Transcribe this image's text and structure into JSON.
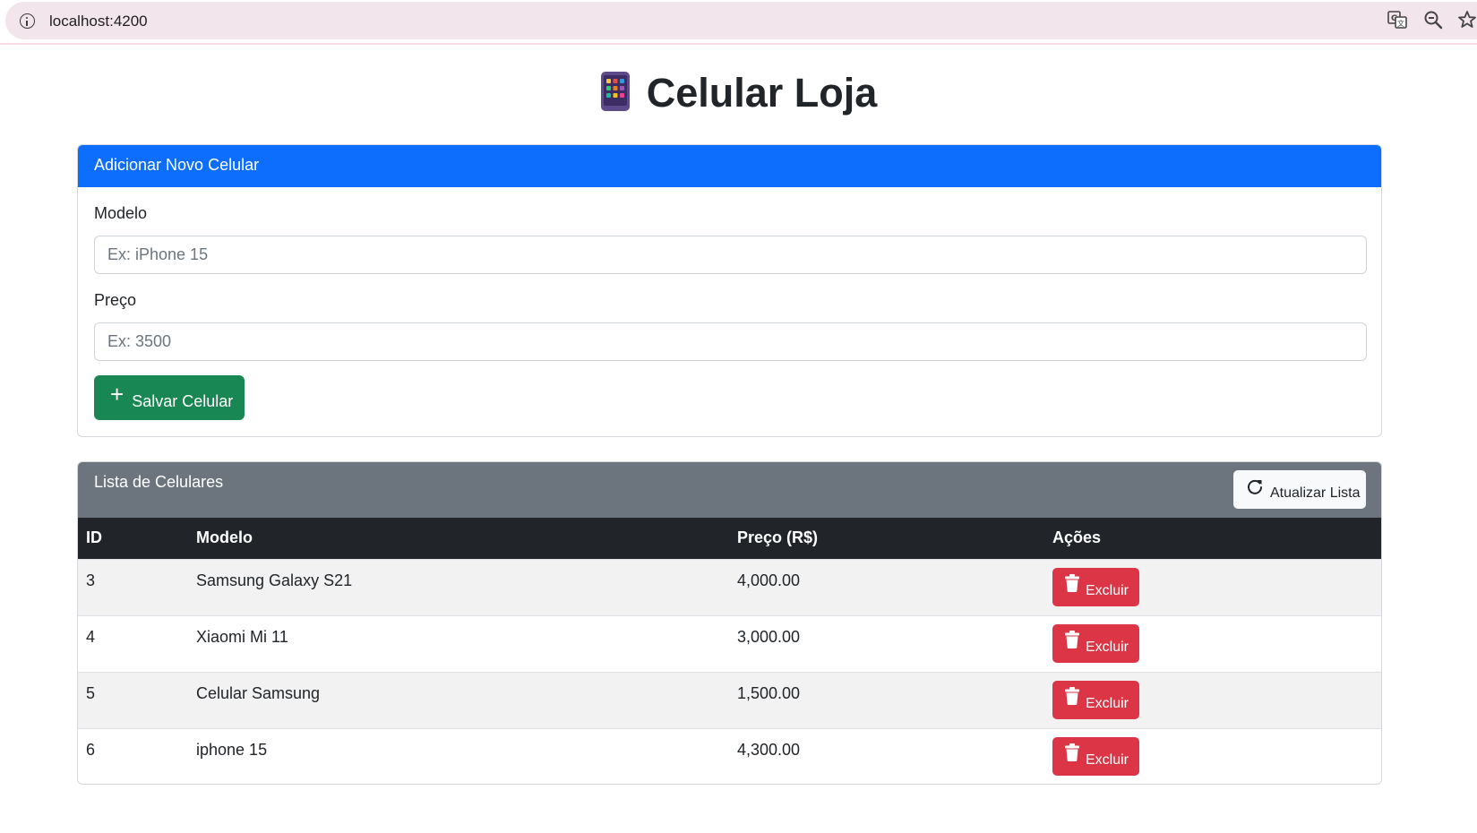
{
  "browser": {
    "url": "localhost:4200",
    "icons": [
      "info-icon",
      "translate-icon",
      "zoom-out-icon",
      "star-icon"
    ]
  },
  "page": {
    "title": "Celular Loja",
    "title_icon": "mobile-phone-emoji"
  },
  "form_card": {
    "header": "Adicionar Novo Celular",
    "modelo_label": "Modelo",
    "modelo_placeholder": "Ex: iPhone 15",
    "modelo_value": "",
    "preco_label": "Preço",
    "preco_placeholder": "Ex: 3500",
    "preco_value": "",
    "save_icon": "plus-icon",
    "save_label": "Salvar Celular"
  },
  "list_card": {
    "header": "Lista de Celulares",
    "refresh_icon": "refresh-icon",
    "refresh_label": "Atualizar Lista",
    "columns": [
      "ID",
      "Modelo",
      "Preço (R$)",
      "Ações"
    ],
    "rows": [
      {
        "id": "3",
        "modelo": "Samsung Galaxy S21",
        "preco": "4,000.00",
        "action": "Excluir"
      },
      {
        "id": "4",
        "modelo": "Xiaomi Mi 11",
        "preco": "3,000.00",
        "action": "Excluir"
      },
      {
        "id": "5",
        "modelo": "Celular Samsung",
        "preco": "1,500.00",
        "action": "Excluir"
      },
      {
        "id": "6",
        "modelo": "iphone 15",
        "preco": "4,300.00",
        "action": "Excluir"
      }
    ],
    "delete_icon": "trash-icon"
  },
  "colors": {
    "primary": "#0d6efd",
    "secondary": "#6c757d",
    "success": "#198754",
    "danger": "#dc3545",
    "dark": "#212529"
  }
}
